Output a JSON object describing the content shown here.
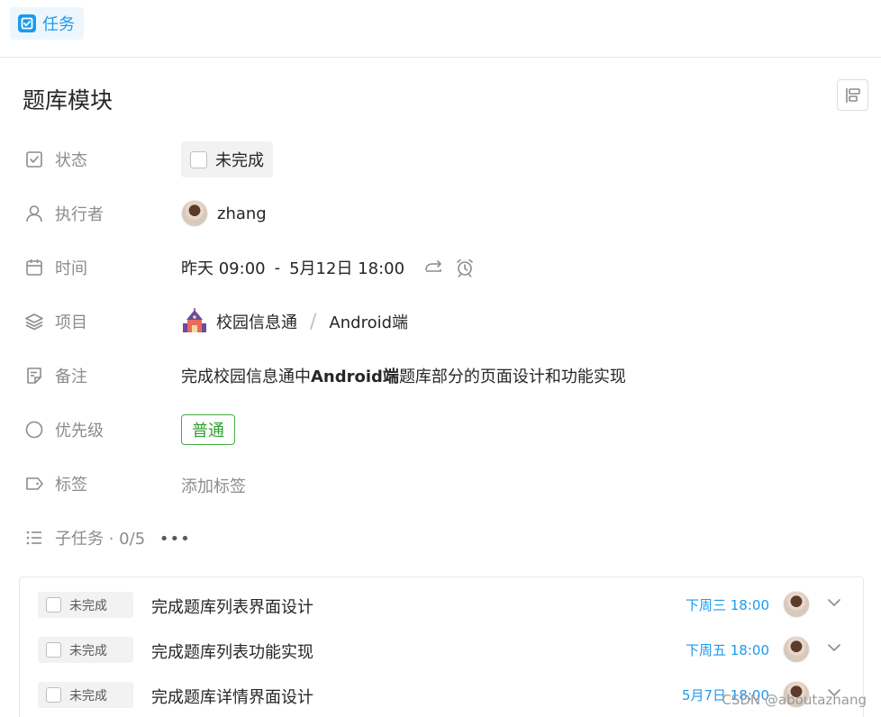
{
  "header": {
    "type_label": "任务",
    "type_icon": "task-checkbox-icon"
  },
  "task": {
    "title": "题库模块"
  },
  "fields": {
    "status": {
      "label": "状态",
      "value": "未完成"
    },
    "assignee": {
      "label": "执行者",
      "name": "zhang"
    },
    "time": {
      "label": "时间",
      "start": "昨天 09:00",
      "dash": "-",
      "end": "5月12日 18:00"
    },
    "project": {
      "label": "项目",
      "name": "校园信息通",
      "separator": "/",
      "section": "Android端"
    },
    "note": {
      "label": "备注",
      "pre": "完成校园信息通中",
      "bold": "Android端",
      "post": "题库部分的页面设计和功能实现"
    },
    "priority": {
      "label": "优先级",
      "value": "普通"
    },
    "tags": {
      "label": "标签",
      "placeholder": "添加标签"
    }
  },
  "subtasks": {
    "label": "子任务 · ",
    "count": "0/5",
    "more": "•••",
    "items": [
      {
        "status": "未完成",
        "title": "完成题库列表界面设计",
        "due": "下周三 18:00"
      },
      {
        "status": "未完成",
        "title": "完成题库列表功能实现",
        "due": "下周五 18:00"
      },
      {
        "status": "未完成",
        "title": "完成题库详情界面设计",
        "due": "5月7日 18:00"
      }
    ]
  },
  "watermark": "CSDN @aboutazhang",
  "colors": {
    "accent": "#1b9aee",
    "priority_green": "#2f9e2f",
    "muted": "#8c8c8c"
  }
}
